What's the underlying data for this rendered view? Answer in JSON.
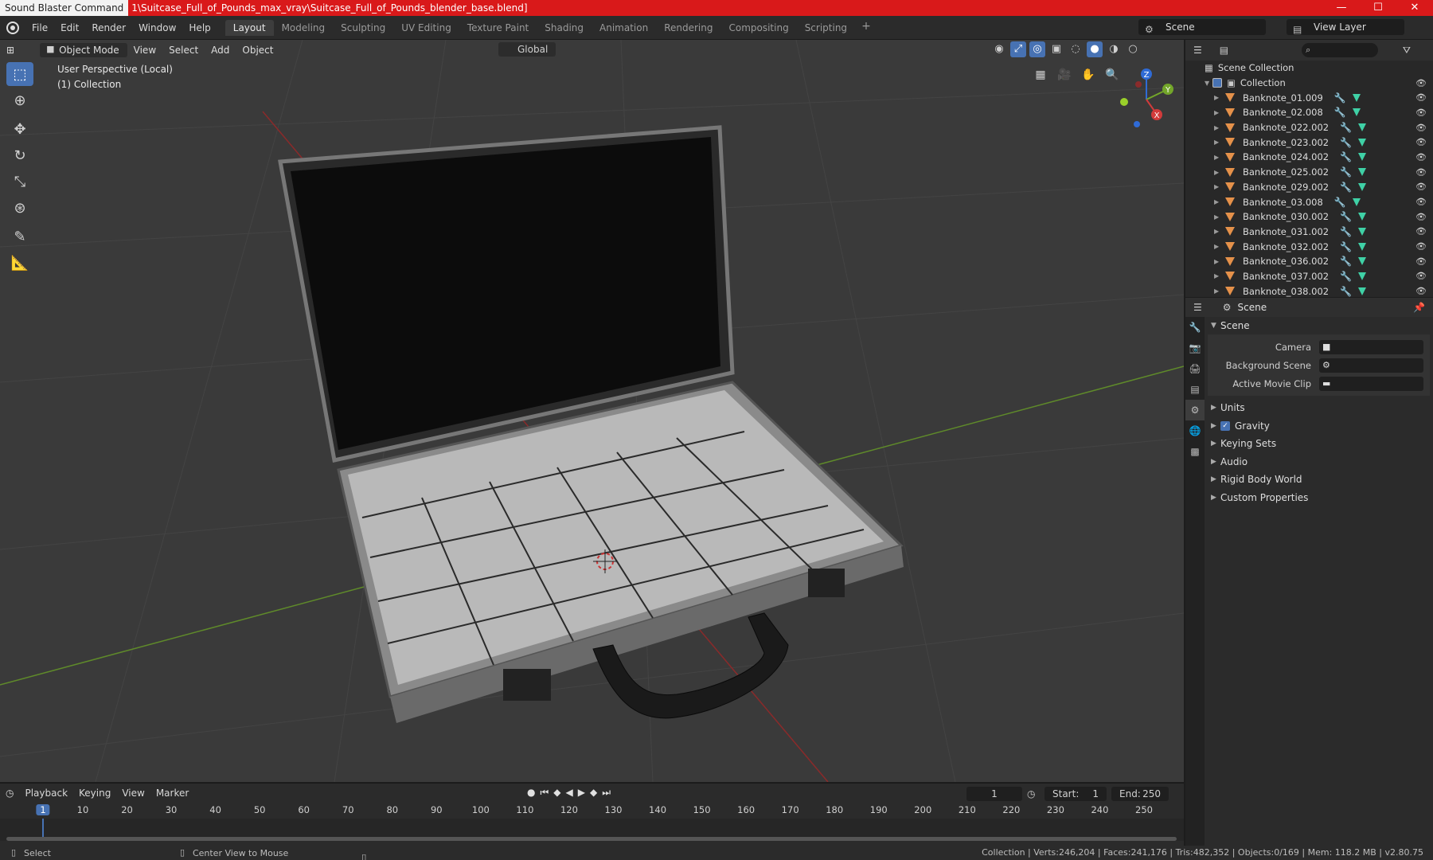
{
  "titlebar": {
    "app": "Sound Blaster Command",
    "path": "1\\Suitcase_Full_of_Pounds_max_vray\\Suitcase_Full_of_Pounds_blender_base.blend]",
    "minimize": "—",
    "maximize": "☐",
    "close": "✕"
  },
  "menu": {
    "file": "File",
    "edit": "Edit",
    "render": "Render",
    "window": "Window",
    "help": "Help"
  },
  "workspaces": [
    "Layout",
    "Modeling",
    "Sculpting",
    "UV Editing",
    "Texture Paint",
    "Shading",
    "Animation",
    "Rendering",
    "Compositing",
    "Scripting"
  ],
  "workspace_add": "+",
  "scene_selector": "Scene",
  "view_layer": "View Layer",
  "viewport": {
    "mode": "Object Mode",
    "menu": [
      "View",
      "Select",
      "Add",
      "Object"
    ],
    "orientation": "Global",
    "info_line1": "User Perspective (Local)",
    "info_line2": "(1) Collection",
    "gizmo": {
      "x": "X",
      "y": "Y",
      "z": "Z"
    }
  },
  "outliner": {
    "root": "Scene Collection",
    "collection": "Collection",
    "items": [
      "Banknote_01.009",
      "Banknote_02.008",
      "Banknote_022.002",
      "Banknote_023.002",
      "Banknote_024.002",
      "Banknote_025.002",
      "Banknote_029.002",
      "Banknote_03.008",
      "Banknote_030.002",
      "Banknote_031.002",
      "Banknote_032.002",
      "Banknote_036.002",
      "Banknote_037.002",
      "Banknote_038.002"
    ]
  },
  "properties": {
    "header": "Scene",
    "panel": "Scene",
    "fields": [
      {
        "label": "Camera",
        "value": ""
      },
      {
        "label": "Background Scene",
        "value": ""
      },
      {
        "label": "Active Movie Clip",
        "value": ""
      }
    ],
    "subpanels": [
      "Units",
      "Gravity",
      "Keying Sets",
      "Audio",
      "Rigid Body World",
      "Custom Properties"
    ]
  },
  "timeline": {
    "menu": [
      "Playback",
      "Keying",
      "View",
      "Marker"
    ],
    "current_frame": "1",
    "start_label": "Start:",
    "start": "1",
    "end_label": "End:",
    "end": "250",
    "ticks": [
      "1",
      "10",
      "20",
      "30",
      "40",
      "50",
      "60",
      "70",
      "80",
      "90",
      "100",
      "110",
      "120",
      "130",
      "140",
      "150",
      "160",
      "170",
      "180",
      "190",
      "200",
      "210",
      "220",
      "230",
      "240",
      "250"
    ]
  },
  "statusbar": {
    "select": "Select",
    "center": "Center View to Mouse",
    "stats": "Collection | Verts:246,204 | Faces:241,176 | Tris:482,352 | Objects:0/169 | Mem: 118.2 MB | v2.80.75"
  }
}
